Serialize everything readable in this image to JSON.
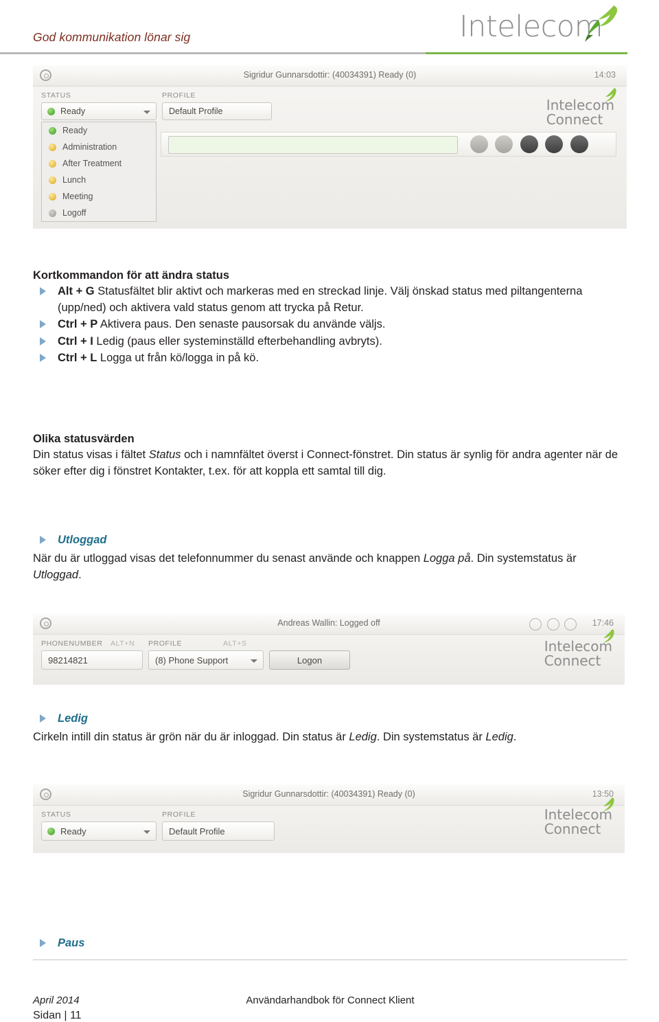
{
  "header": {
    "slogan": "God kommunikation lönar sig",
    "logo_text": "Intelecom"
  },
  "screenshot_ready": {
    "title": "Sigridur Gunnarsdottir: (40034391) Ready (0)",
    "clock": "14:03",
    "status_label": "STATUS",
    "profile_label": "PROFILE",
    "status_value": "Ready",
    "profile_value": "Default Profile",
    "logo_line1": "Intelecom",
    "logo_line2": "Connect",
    "dropdown": [
      {
        "label": "Ready",
        "dot": "green"
      },
      {
        "label": "Administration",
        "dot": "yellow"
      },
      {
        "label": "After Treatment",
        "dot": "yellow"
      },
      {
        "label": "Lunch",
        "dot": "yellow"
      },
      {
        "label": "Meeting",
        "dot": "yellow"
      },
      {
        "label": "Logoff",
        "dot": "grey"
      }
    ]
  },
  "section_shortcuts": {
    "heading": "Kortkommandon för att ändra status",
    "items": [
      {
        "key": "Alt + G",
        "text": " Statusfältet blir aktivt och markeras med en streckad linje. Välj önskad status med piltangenterna (upp/ned) och aktivera vald status genom att trycka på Retur."
      },
      {
        "key": "Ctrl + P",
        "text": " Aktivera paus. Den senaste pausorsak du använde väljs."
      },
      {
        "key": "Ctrl + I",
        "text": " Ledig (paus eller systeminställd efterbehandling avbryts)."
      },
      {
        "key": "Ctrl + L",
        "text": " Logga ut från kö/logga in på kö."
      }
    ]
  },
  "section_statusvarden": {
    "heading": "Olika statusvärden",
    "paragraph_part1": "Din status visas i fältet ",
    "paragraph_em1": "Status",
    "paragraph_part2": " och i namnfältet överst i Connect-fönstret. Din status är synlig för andra agenter när de söker efter dig i fönstret Kontakter, t.ex. för att koppla ett samtal till dig."
  },
  "item_utloggad": {
    "heading": "Utloggad",
    "text_part1": "När du är utloggad visas det telefonnummer du senast använde och knappen ",
    "text_em": "Logga på",
    "text_part2": ". Din systemstatus är ",
    "text_em2": "Utloggad",
    "text_part3": "."
  },
  "screenshot_loggedoff": {
    "title": "Andreas Wallin: Logged off",
    "clock": "17:46",
    "phonenumber_label": "PHONENUMBER",
    "phonenumber_hint": "ALT+N",
    "profile_label": "PROFILE",
    "profile_hint": "ALT+S",
    "phonenumber_value": "98214821",
    "profile_value": "(8) Phone Support",
    "logon_button": "Logon",
    "logo_line1": "Intelecom",
    "logo_line2": "Connect"
  },
  "item_ledig": {
    "heading": "Ledig",
    "text_part1": "Cirkeln intill din status är grön när du är inloggad. Din status är ",
    "text_em1": "Ledig",
    "text_part2": ". Din systemstatus är ",
    "text_em2": "Ledig",
    "text_part3": "."
  },
  "screenshot_ledig": {
    "title": "Sigridur Gunnarsdottir: (40034391) Ready (0)",
    "clock": "13:50",
    "status_label": "STATUS",
    "profile_label": "PROFILE",
    "status_value": "Ready",
    "profile_value": "Default Profile",
    "logo_line1": "Intelecom",
    "logo_line2": "Connect"
  },
  "item_paus": {
    "heading": "Paus"
  },
  "footer": {
    "left": "April 2014",
    "center": "Användarhandbok för Connect Klient",
    "page": "Sidan | 11"
  }
}
